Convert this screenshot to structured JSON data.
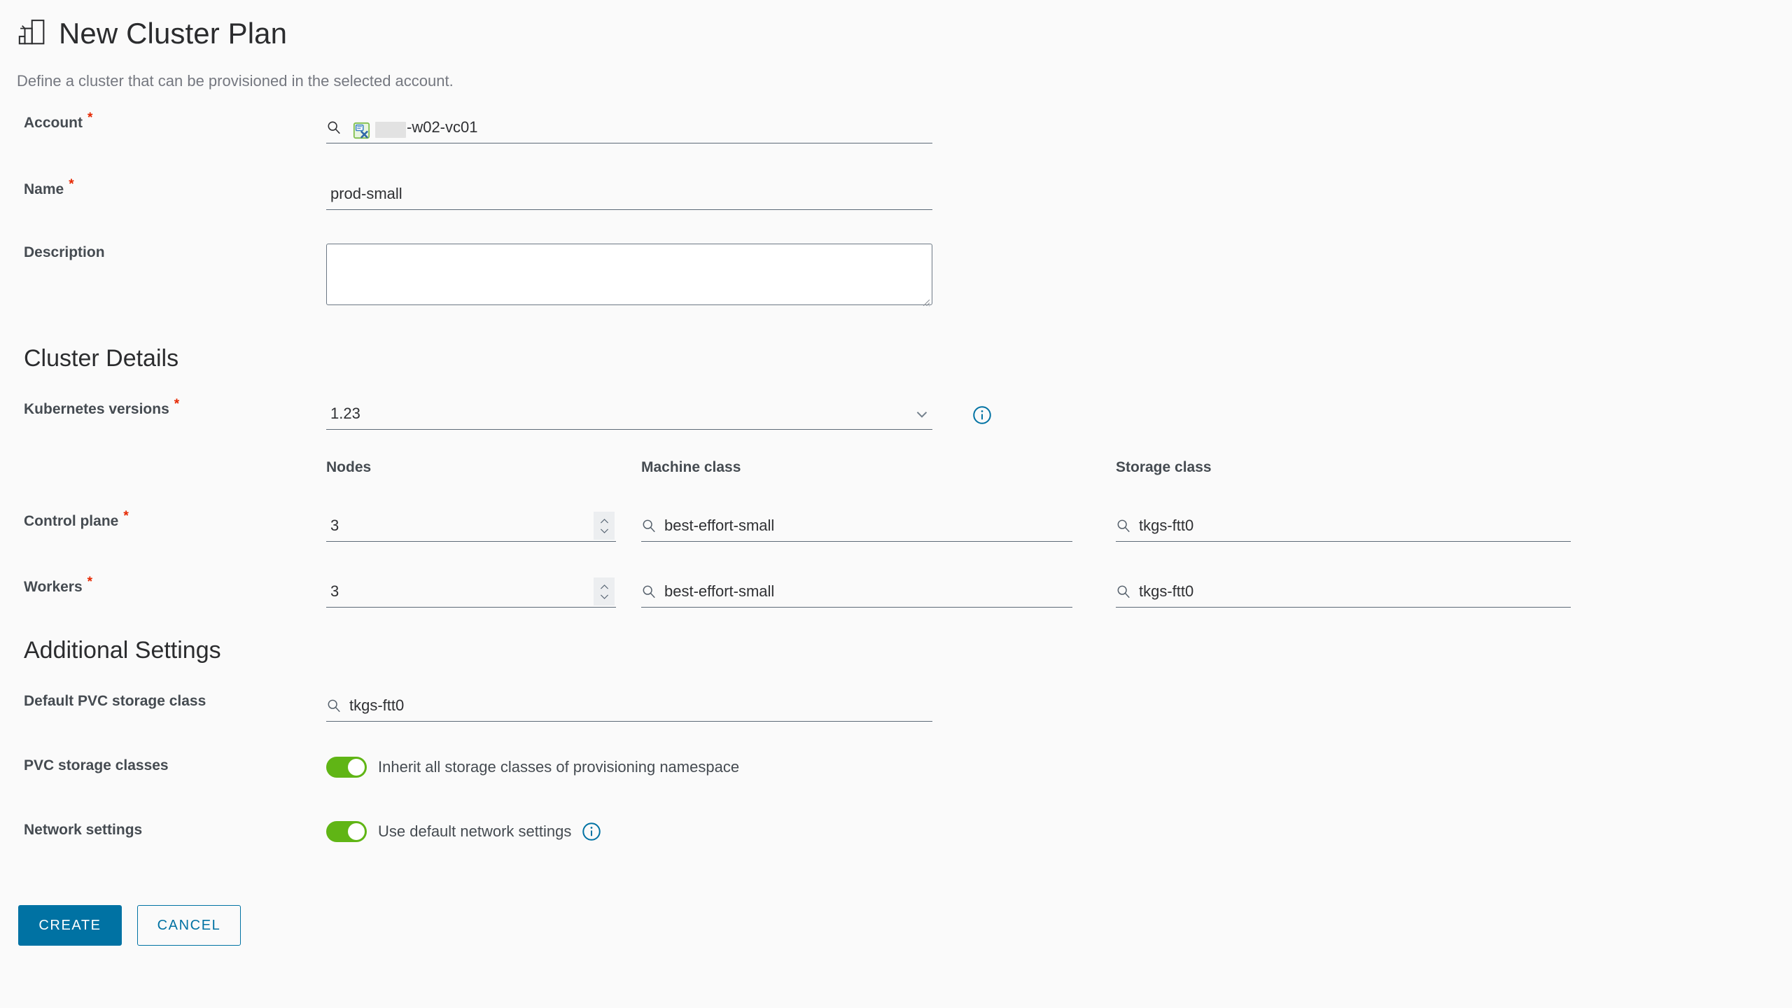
{
  "header": {
    "icon": "cluster-plan-icon",
    "title": "New Cluster Plan",
    "subtitle": "Define a cluster that can be provisioned in the selected account."
  },
  "form": {
    "account": {
      "label": "Account",
      "required_marker": "*",
      "search_icon": "search-icon",
      "resource_icon": "vcenter-icon",
      "value": "-w02-vc01",
      "redacted": true
    },
    "name": {
      "label": "Name",
      "required_marker": "*",
      "value": "prod-small"
    },
    "description": {
      "label": "Description",
      "value": "",
      "placeholder": ""
    }
  },
  "cluster_details": {
    "heading": "Cluster Details",
    "kubernetes_versions": {
      "label": "Kubernetes versions",
      "required_marker": "*",
      "value": "1.23",
      "chevron_icon": "chevron-down-icon",
      "info_icon": "info-icon"
    },
    "columns": {
      "nodes": "Nodes",
      "machine_class": "Machine class",
      "storage_class": "Storage class"
    },
    "rows": [
      {
        "label": "Control plane",
        "required_marker": "*",
        "nodes": "3",
        "machine_class": "best-effort-small",
        "storage_class": "tkgs-ftt0"
      },
      {
        "label": "Workers",
        "required_marker": "*",
        "nodes": "3",
        "machine_class": "best-effort-small",
        "storage_class": "tkgs-ftt0"
      }
    ]
  },
  "additional_settings": {
    "heading": "Additional Settings",
    "default_pvc_storage_class": {
      "label": "Default PVC storage class",
      "value": "tkgs-ftt0",
      "search_icon": "search-icon"
    },
    "pvc_storage_classes": {
      "label": "PVC storage classes",
      "toggle_label": "Inherit all storage classes of provisioning namespace",
      "toggle_on": true
    },
    "network_settings": {
      "label": "Network settings",
      "toggle_label": "Use default network settings",
      "toggle_on": true,
      "info_icon": "info-icon"
    }
  },
  "actions": {
    "create_label": "CREATE",
    "cancel_label": "CANCEL"
  },
  "colors": {
    "accent_blue": "#0072a3",
    "toggle_green": "#60b515",
    "required_red": "#e62700",
    "background": "#fafafa",
    "label_text": "#454b51",
    "underline": "#5c6977"
  }
}
